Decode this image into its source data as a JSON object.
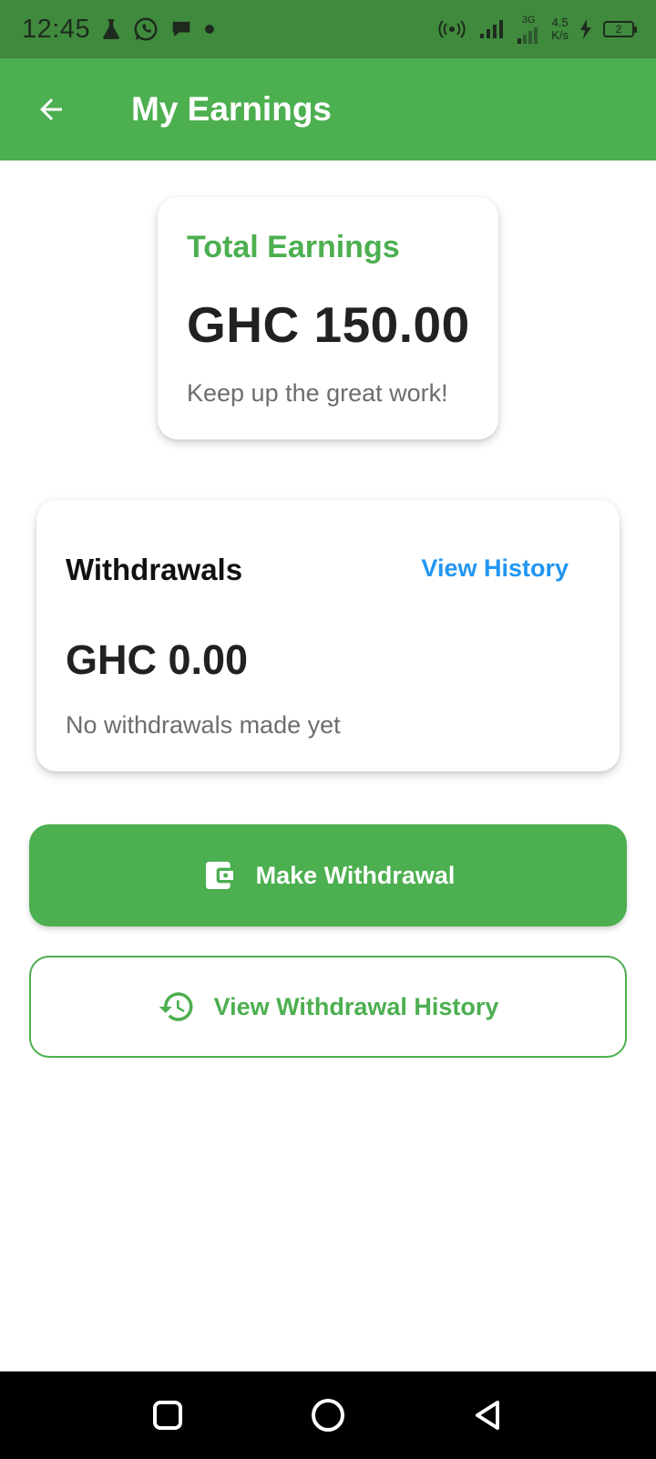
{
  "status_bar": {
    "time": "12:45",
    "net_speed_value": "4.5",
    "net_speed_unit": "K/s",
    "network_type": "3G",
    "battery_level": "2"
  },
  "app_bar": {
    "title": "My Earnings"
  },
  "earnings_card": {
    "label": "Total Earnings",
    "amount": "GHC 150.00",
    "message": "Keep up the great work!"
  },
  "withdrawals_card": {
    "title": "Withdrawals",
    "link": "View History",
    "amount": "GHC 0.00",
    "message": "No withdrawals made yet"
  },
  "buttons": {
    "make_withdrawal": "Make Withdrawal",
    "view_withdrawal_history": "View Withdrawal History"
  },
  "colors": {
    "primary_green": "#4caf50",
    "status_bar_green": "#3f8a3d",
    "link_blue": "#2196f3"
  },
  "icons": {
    "back": "arrow-back-icon",
    "wallet": "wallet-icon",
    "history": "history-icon"
  }
}
